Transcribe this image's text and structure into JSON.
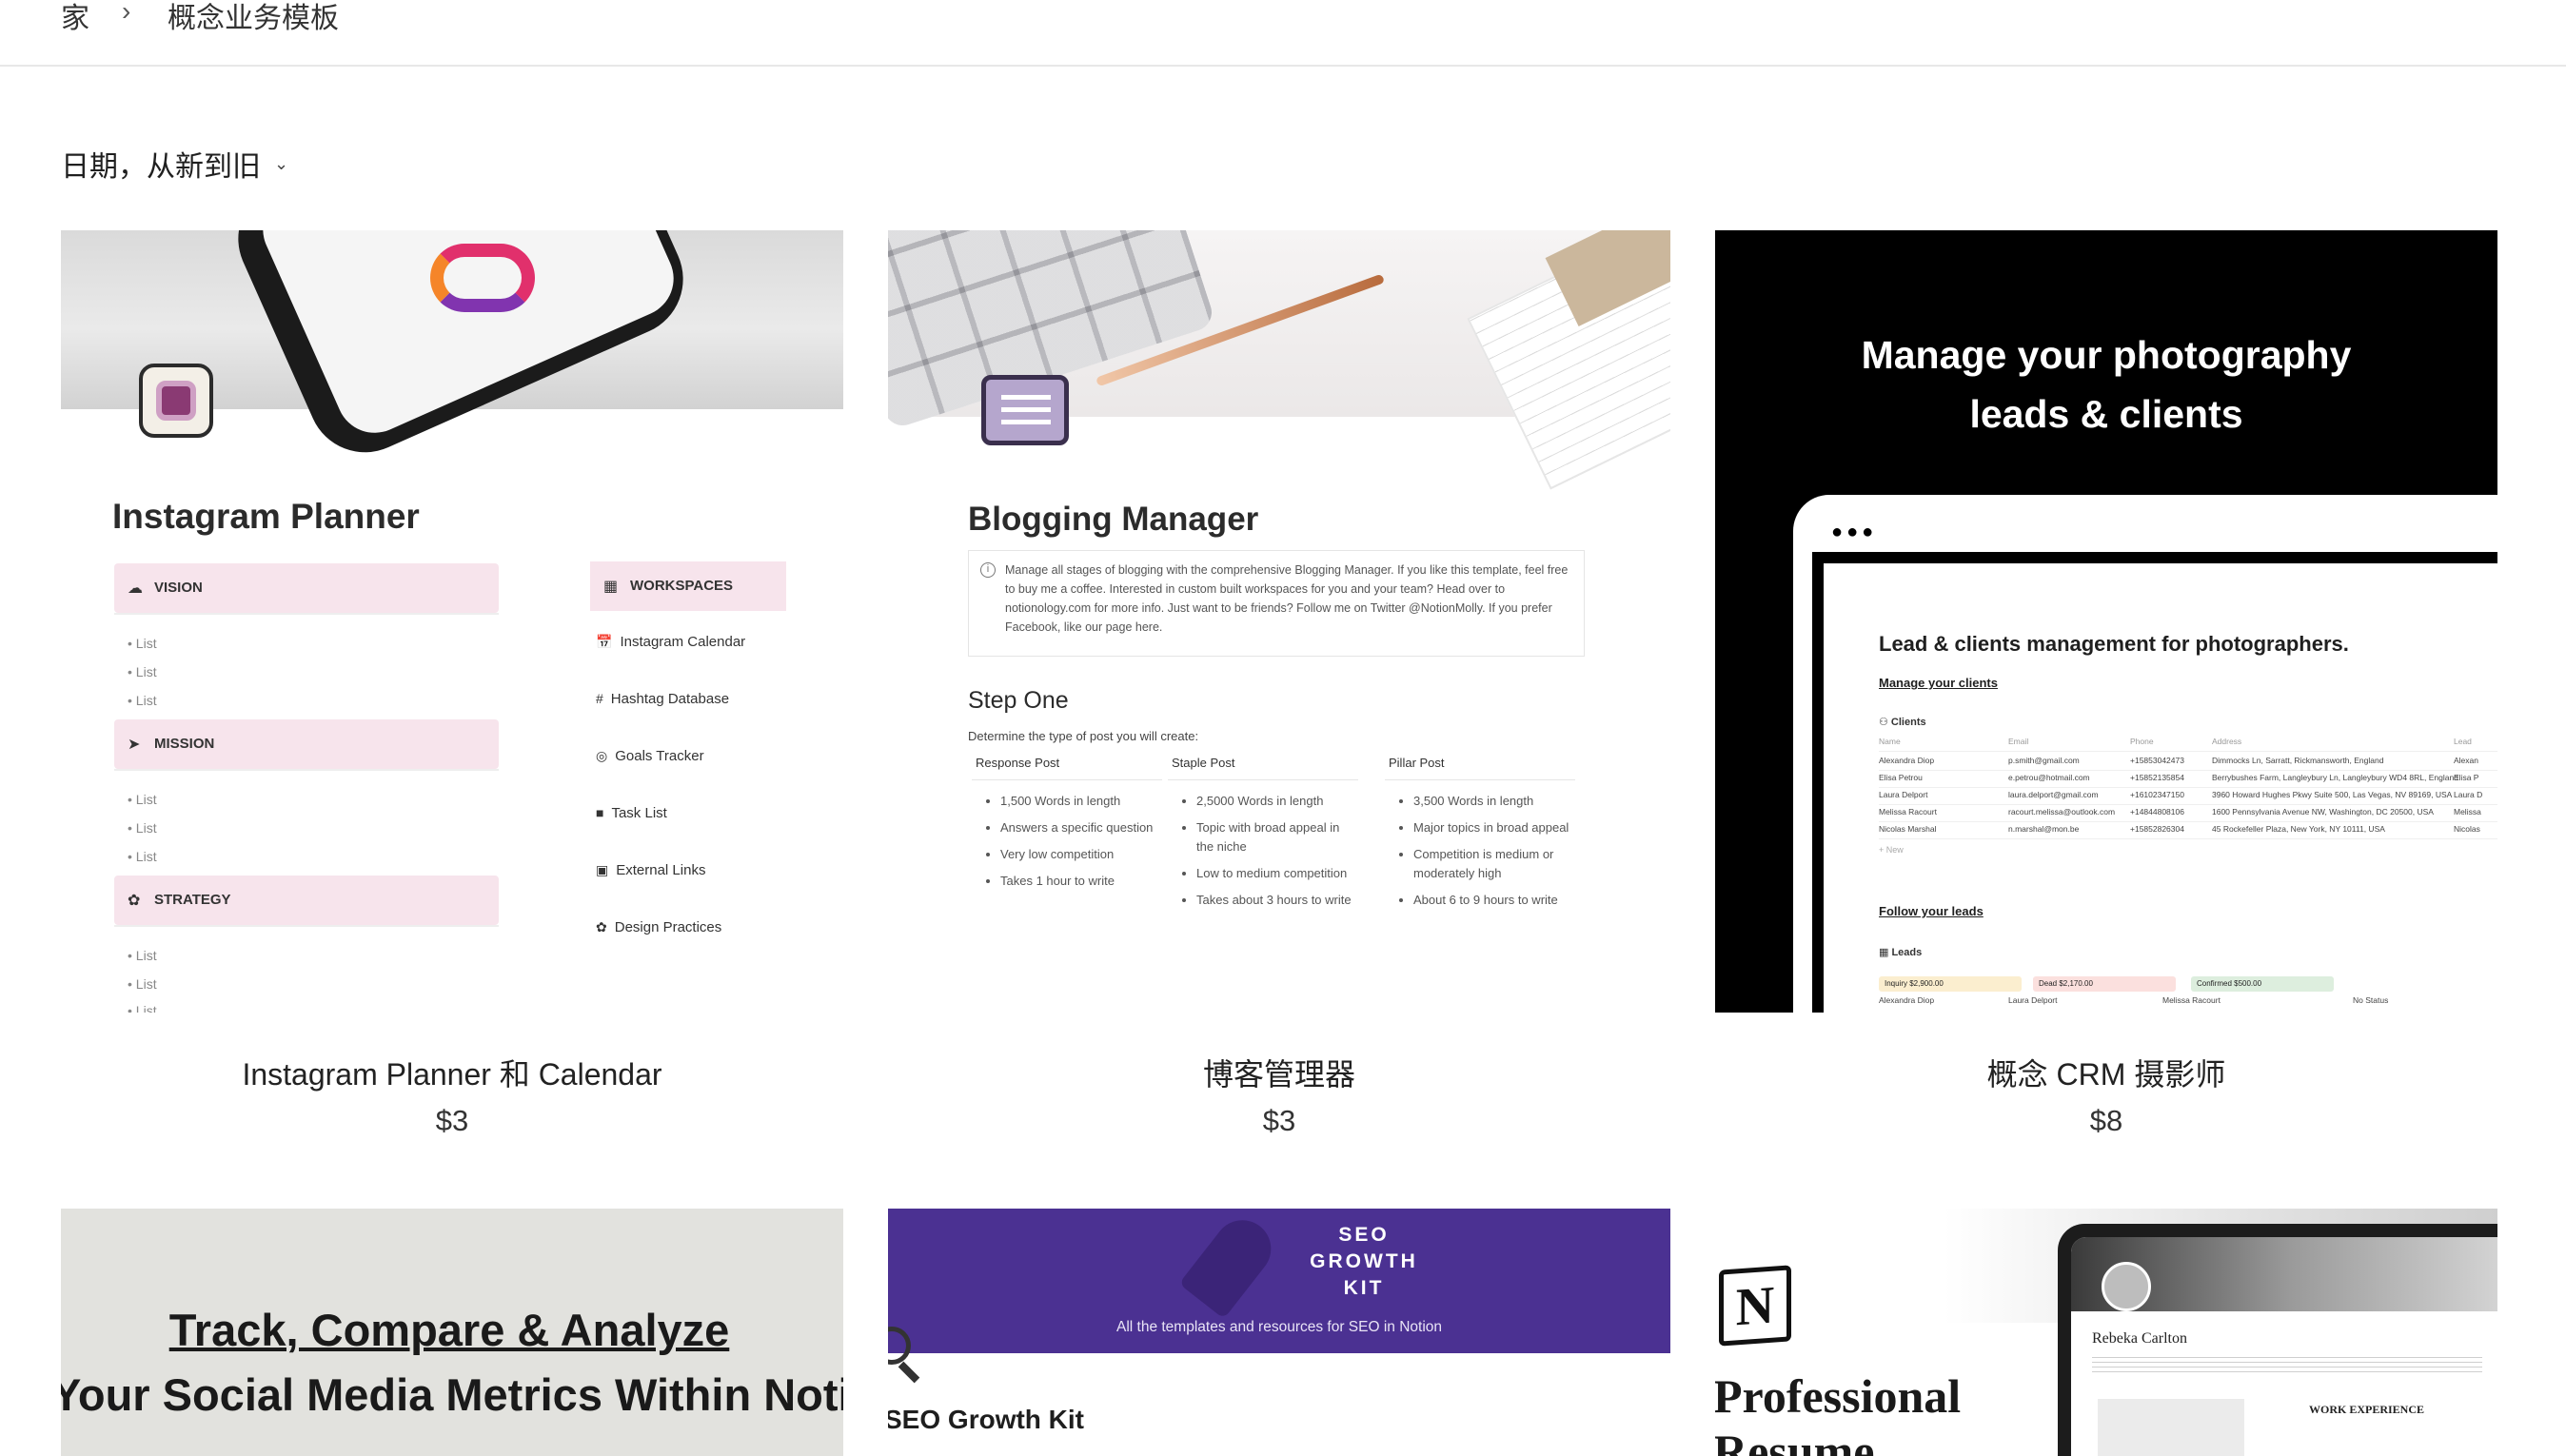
{
  "breadcrumb": {
    "home": "家",
    "separator": "›",
    "current": "概念业务模板"
  },
  "sort": {
    "label": "日期，从新到旧",
    "chevron_icon": "chevron-down-icon"
  },
  "products": [
    {
      "title": "Instagram Planner 和 Calendar",
      "price": "$3",
      "thumb": {
        "heading": "Instagram Planner",
        "sections": [
          "VISION",
          "MISSION",
          "STRATEGY"
        ],
        "list_item": "List",
        "workspaces_label": "WORKSPACES",
        "workspace_items": [
          "Instagram Calendar",
          "Hashtag Database",
          "Goals Tracker",
          "Task List",
          "External Links",
          "Design Practices"
        ]
      }
    },
    {
      "title": "博客管理器",
      "price": "$3",
      "thumb": {
        "heading": "Blogging Manager",
        "info_text": "Manage all stages of blogging with the comprehensive Blogging Manager. If you like this template, feel free to buy me a coffee. Interested in custom built workspaces for you and your team? Head over to notionology.com for more info. Just want to be friends? Follow me on Twitter @NotionMolly. If you prefer Facebook, like our page here.",
        "step": "Step One",
        "step_sub": "Determine the type of post you will create:",
        "columns": [
          {
            "name": "Response Post",
            "items": [
              "1,500 Words in length",
              "Answers a specific question",
              "Very low competition",
              "Takes 1 hour to write"
            ]
          },
          {
            "name": "Staple Post",
            "items": [
              "2,5000 Words in length",
              "Topic with broad appeal in the niche",
              "Low to medium competition",
              "Takes about 3 hours to write"
            ]
          },
          {
            "name": "Pillar Post",
            "items": [
              "3,500 Words in length",
              "Major topics in broad appeal",
              "Competition is medium or moderately high",
              "About 6 to 9 hours to write"
            ]
          }
        ]
      }
    },
    {
      "title": "概念 CRM 摄影师",
      "price": "$8",
      "thumb": {
        "headline_1": "Manage your photography",
        "headline_2": "leads & clients",
        "screen_heading": "Lead & clients management for photographers.",
        "manage_label": "Manage your clients",
        "clients_label": "Clients",
        "table_header": [
          "Name",
          "Email",
          "Phone",
          "Address",
          "Lead"
        ],
        "rows": [
          [
            "Alexandra Diop",
            "p.smith@gmail.com",
            "+15853042473",
            "Dimmocks Ln, Sarratt, Rickmansworth, England",
            "Alexan"
          ],
          [
            "Elisa Petrou",
            "e.petrou@hotmail.com",
            "+15852135854",
            "Berrybushes Farm, Langleybury Ln, Langleybury WD4 8RL, England",
            "Elisa P"
          ],
          [
            "Laura Delport",
            "laura.delport@gmail.com",
            "+16102347150",
            "3960 Howard Hughes Pkwy Suite 500, Las Vegas, NV 89169, USA",
            "Laura D"
          ],
          [
            "Melissa Racourt",
            "racourt.melissa@outlook.com",
            "+14844808106",
            "1600 Pennsylvania Avenue NW, Washington, DC 20500, USA",
            "Melissa"
          ],
          [
            "Nicolas Marshal",
            "n.marshal@mon.be",
            "+15852826304",
            "45 Rockefeller Plaza, New York, NY 10111, USA",
            "Nicolas"
          ]
        ],
        "new_label": "+ New",
        "follow_label": "Follow your leads",
        "leads_label": "Leads",
        "lead_chips": [
          {
            "label": "Inquiry  $2,900.00",
            "color": "#fbeecf"
          },
          {
            "label": "Dead  $2,170.00",
            "color": "#fbe0de"
          },
          {
            "label": "Confirmed  $500.00",
            "color": "#ddeede"
          }
        ],
        "lead_names": [
          "Alexandra Diop",
          "Laura Delport",
          "Melissa Racourt",
          "No Status"
        ]
      }
    },
    {
      "title": "",
      "price": "",
      "thumb": {
        "line_1": "Track, Compare & Analyze",
        "line_2": "Your Social Media Metrics Within Notion"
      }
    },
    {
      "title": "",
      "price": "",
      "thumb": {
        "kit_title": "SEO\nGROWTH\nKIT",
        "band_sub": "All the templates and resources for SEO in Notion",
        "heading": "SEO Growth Kit"
      }
    },
    {
      "title": "",
      "price": "",
      "thumb": {
        "logo_letter": "N",
        "title_1": "Professional",
        "title_2": "Resume",
        "person_name": "Rebeka Carlton",
        "section": "WORK EXPERIENCE"
      }
    }
  ],
  "colors": {
    "instagram_section": "#f7e4ec",
    "seo_band": "#4b3192",
    "crm_bg": "#000000",
    "social_bg": "#e2e2de"
  }
}
